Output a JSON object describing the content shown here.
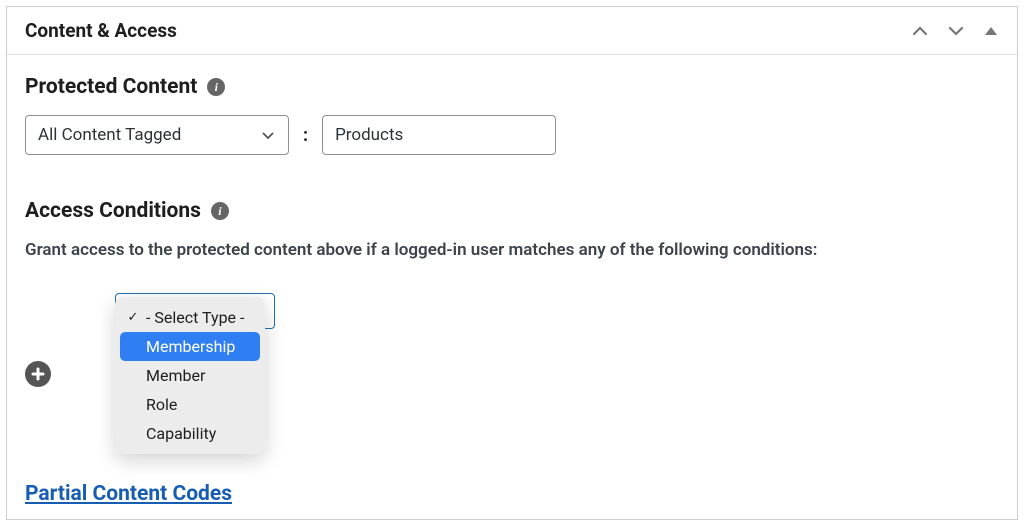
{
  "panel": {
    "title": "Content & Access"
  },
  "protected_content": {
    "heading": "Protected Content",
    "tag_select": "All Content Tagged",
    "separator": ":",
    "tag_value": "Products"
  },
  "access_conditions": {
    "heading": "Access Conditions",
    "description": "Grant access to the protected content above if a logged-in user matches any of the following conditions:",
    "dropdown": {
      "placeholder": "- Select Type -",
      "options": [
        {
          "label": "- Select Type -",
          "selected": true,
          "highlighted": false
        },
        {
          "label": "Membership",
          "selected": false,
          "highlighted": true
        },
        {
          "label": "Member",
          "selected": false,
          "highlighted": false
        },
        {
          "label": "Role",
          "selected": false,
          "highlighted": false
        },
        {
          "label": "Capability",
          "selected": false,
          "highlighted": false
        }
      ]
    }
  },
  "partial_codes_link": "Partial Content Codes"
}
